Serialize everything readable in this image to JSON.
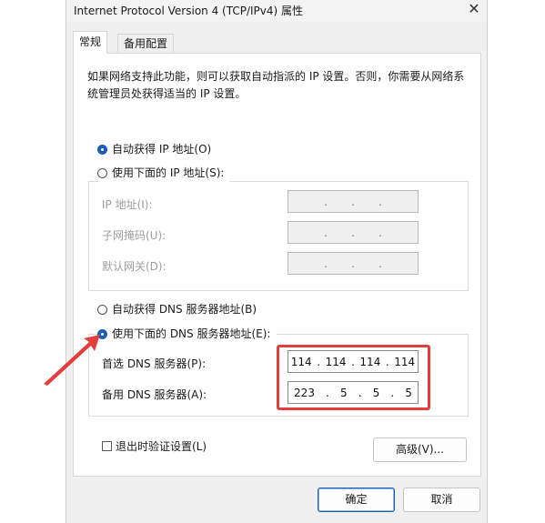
{
  "window": {
    "title": "Internet Protocol Version 4 (TCP/IPv4) 属性"
  },
  "tabs": [
    {
      "label": "常规"
    },
    {
      "label": "备用配置"
    }
  ],
  "description": "如果网络支持此功能，则可以获取自动指派的 IP 设置。否则，你需要从网络系统管理员处获得适当的 IP 设置。",
  "ip": {
    "auto_label": "自动获得 IP 地址(O)",
    "manual_label": "使用下面的 IP 地址(S):",
    "address_label": "IP 地址(I):",
    "subnet_label": "子网掩码(U):",
    "gateway_label": "默认网关(D):"
  },
  "dns": {
    "auto_label": "自动获得 DNS 服务器地址(B)",
    "manual_label": "使用下面的 DNS 服务器地址(E):",
    "preferred_label": "首选 DNS 服务器(P):",
    "alternate_label": "备用 DNS 服务器(A):",
    "preferred": [
      "114",
      "114",
      "114",
      "114"
    ],
    "alternate": [
      "223",
      "5",
      "5",
      "5"
    ]
  },
  "validate_on_exit_label": "退出时验证设置(L)",
  "buttons": {
    "advanced": "高级(V)...",
    "ok": "确定",
    "cancel": "取消"
  },
  "colors": {
    "accent": "#1a5fb4",
    "highlight": "#e43d3d"
  }
}
